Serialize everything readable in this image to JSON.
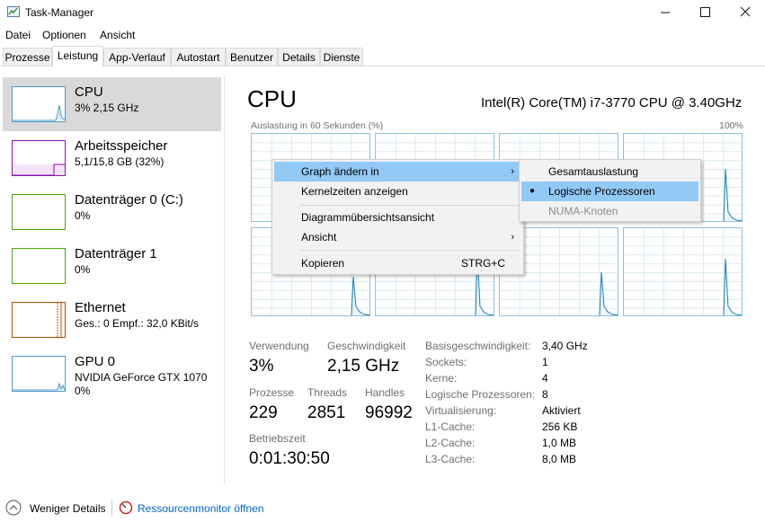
{
  "window": {
    "title": "Task-Manager",
    "minimize": "—",
    "maximize": "☐",
    "close": "✕"
  },
  "menu": [
    "Datei",
    "Optionen",
    "Ansicht"
  ],
  "tabs": [
    "Prozesse",
    "Leistung",
    "App-Verlauf",
    "Autostart",
    "Benutzer",
    "Details",
    "Dienste"
  ],
  "active_tab": "Leistung",
  "sidebar": [
    {
      "name": "CPU",
      "sub1": "3% 2,15 GHz",
      "sub2": "",
      "color": "#4e9ac9",
      "selected": true
    },
    {
      "name": "Arbeitsspeicher",
      "sub1": "5,1/15,8 GB (32%)",
      "sub2": "",
      "color": "#8b12ae",
      "selected": false
    },
    {
      "name": "Datenträger 0 (C:)",
      "sub1": "0%",
      "sub2": "",
      "color": "#4da60c",
      "selected": false
    },
    {
      "name": "Datenträger 1",
      "sub1": "0%",
      "sub2": "",
      "color": "#4da60c",
      "selected": false
    },
    {
      "name": "Ethernet",
      "sub1": "Ges.: 0 Empf.: 32,0 KBit/s",
      "sub2": "",
      "color": "#a74f01",
      "selected": false
    },
    {
      "name": "GPU 0",
      "sub1": "NVIDIA GeForce GTX 1070",
      "sub2": "0%",
      "color": "#4e9ac9",
      "selected": false
    }
  ],
  "main": {
    "title": "CPU",
    "model": "Intel(R) Core(TM) i7-3770 CPU @ 3.40GHz",
    "graph_caption": "Auslastung in 60 Sekunden (%)",
    "graph_max": "100%",
    "graph_color": "#117dbb",
    "logical_cpus": 8
  },
  "stats": {
    "usage_label": "Verwendung",
    "usage_value": "3%",
    "speed_label": "Geschwindigkeit",
    "speed_value": "2,15 GHz",
    "processes_label": "Prozesse",
    "processes_value": "229",
    "threads_label": "Threads",
    "threads_value": "2851",
    "handles_label": "Handles",
    "handles_value": "96992",
    "uptime_label": "Betriebszeit",
    "uptime_value": "0:01:30:50"
  },
  "info": [
    {
      "label": "Basisgeschwindigkeit:",
      "value": "3,40 GHz"
    },
    {
      "label": "Sockets:",
      "value": "1"
    },
    {
      "label": "Kerne:",
      "value": "4"
    },
    {
      "label": "Logische Prozessoren:",
      "value": "8"
    },
    {
      "label": "Virtualisierung:",
      "value": "Aktiviert"
    },
    {
      "label": "L1-Cache:",
      "value": "256 KB"
    },
    {
      "label": "L2-Cache:",
      "value": "1,0 MB"
    },
    {
      "label": "L3-Cache:",
      "value": "8,0 MB"
    }
  ],
  "context_menu": {
    "items": [
      {
        "label": "Graph ändern in",
        "submenu": true,
        "highlighted": true
      },
      {
        "label": "Kernelzeiten anzeigen"
      },
      {
        "label": "Diagrammübersichtsansicht"
      },
      {
        "label": "Ansicht",
        "submenu": true
      },
      {
        "label": "Kopieren",
        "shortcut": "STRG+C"
      }
    ],
    "submenu": [
      {
        "label": "Gesamtauslastung",
        "checked": false
      },
      {
        "label": "Logische Prozessoren",
        "checked": true,
        "highlighted": true
      },
      {
        "label": "NUMA-Knoten",
        "disabled": true
      }
    ]
  },
  "footer": {
    "fewer_details": "Weniger Details",
    "resource_monitor": "Ressourcenmonitor öffnen",
    "link_color": "#0066cc"
  }
}
